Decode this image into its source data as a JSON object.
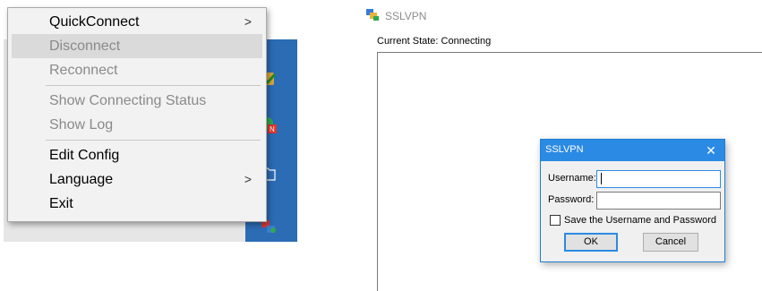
{
  "context_menu": {
    "items": [
      {
        "label": "QuickConnect",
        "state": "enabled",
        "submenu": true
      },
      {
        "label": "Disconnect",
        "state": "disabled-highlighted",
        "submenu": false
      },
      {
        "label": "Reconnect",
        "state": "disabled",
        "submenu": false
      },
      {
        "label": "Show Connecting Status",
        "state": "disabled",
        "submenu": false
      },
      {
        "label": "Show Log",
        "state": "disabled",
        "submenu": false
      },
      {
        "label": "Edit Config",
        "state": "enabled",
        "submenu": false
      },
      {
        "label": "Language",
        "state": "enabled",
        "submenu": true
      },
      {
        "label": "Exit",
        "state": "enabled",
        "submenu": false
      }
    ],
    "submenu_arrow": ">"
  },
  "tray": {
    "icons": [
      "checkmark-shield-icon",
      "n-badge-icon",
      "folder-outline-icon",
      "sslvpn-tray-icon"
    ],
    "taskbar_color": "#2b6cb5"
  },
  "app_window": {
    "title": "SSLVPN",
    "state_text": "Current State: Connecting"
  },
  "login_dialog": {
    "title": "SSLVPN",
    "close_glyph": "✕",
    "username_label": "Username:",
    "username_value": "",
    "password_label": "Password:",
    "password_value": "",
    "save_label": "Save the Username and Password",
    "save_checked": false,
    "ok_label": "OK",
    "cancel_label": "Cancel",
    "accent_color": "#2b8ae3"
  }
}
